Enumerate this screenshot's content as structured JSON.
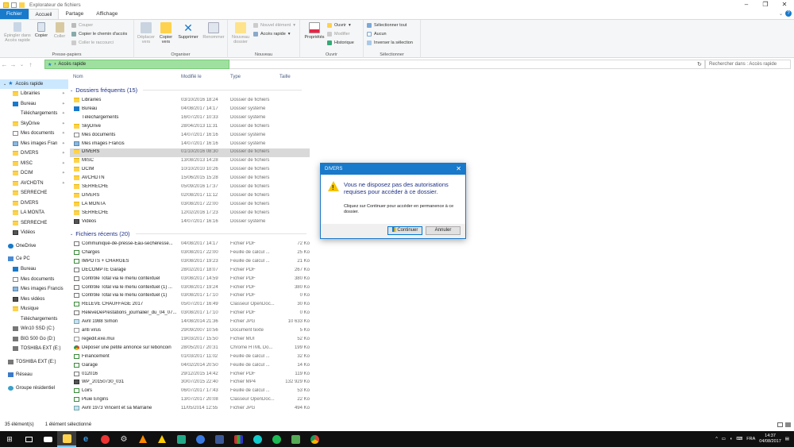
{
  "window": {
    "title": "Explorateur de fichiers"
  },
  "tabs": [
    "Fichier",
    "Accueil",
    "Partage",
    "Affichage"
  ],
  "ribbon": {
    "clipboard": {
      "pin": "Épingler dans Accès rapide",
      "copy": "Copier",
      "paste": "Coller",
      "cut": "Couper",
      "copy_path": "Copier le chemin d'accès",
      "paste_shortcut": "Coller le raccourci",
      "label": "Presse-papiers"
    },
    "organize": {
      "move": "Déplacer vers",
      "copy_to": "Copier vers",
      "delete": "Supprimer",
      "rename": "Renommer",
      "label": "Organiser"
    },
    "new": {
      "new_folder": "Nouveau dossier",
      "new_item": "Nouvel élément",
      "easy_access": "Accès rapide",
      "label": "Nouveau"
    },
    "open": {
      "properties": "Propriétés",
      "open": "Ouvrir",
      "edit": "Modifier",
      "history": "Historique",
      "label": "Ouvrir"
    },
    "select": {
      "select_all": "Sélectionner tout",
      "select_none": "Aucun",
      "invert": "Inverser la sélection",
      "label": "Sélectionner"
    }
  },
  "address": {
    "path": "Accès rapide",
    "search_placeholder": "Rechercher dans : Accès rapide"
  },
  "nav": {
    "quick_access": "Accès rapide",
    "pinned": [
      "Librairies",
      "Bureau",
      "Téléchargements",
      "SkyDrive",
      "Mes documents",
      "Mes images Fran",
      "DIVERS",
      "MISC",
      "DCIM",
      "AVCHDTN",
      "SERRECHE",
      "DIVERS",
      "LA MONTA",
      "SERRECHE",
      "Vidéos"
    ],
    "onedrive": "OneDrive",
    "this_pc": "Ce PC",
    "pc_items": [
      "Bureau",
      "Mes documents",
      "Mes images Francis",
      "Mes vidéos",
      "Musique",
      "Téléchargements",
      "Win10 SSD (C:)",
      "BIG 500 Go (D:)",
      "TOSHIBA EXT (E:)"
    ],
    "toshiba": "TOSHIBA EXT (E:)",
    "network": "Réseau",
    "homegroup": "Groupe résidentiel"
  },
  "columns": {
    "name": "Nom",
    "modified": "Modifié le",
    "type": "Type",
    "size": "Taille"
  },
  "frequent": {
    "header": "Dossiers fréquents (15)",
    "rows": [
      {
        "name": "Librairies",
        "date": "03/10/2016 18:24",
        "type": "Dossier de fichiers",
        "size": "",
        "icon": "folder"
      },
      {
        "name": "Bureau",
        "date": "04/08/2017 14:17",
        "type": "Dossier système",
        "size": "",
        "icon": "desktop"
      },
      {
        "name": "Téléchargements",
        "date": "16/07/2017 10:33",
        "type": "Dossier système",
        "size": "",
        "icon": "download"
      },
      {
        "name": "SkyDrive",
        "date": "28/04/2013 11:31",
        "type": "Dossier de fichiers",
        "size": "",
        "icon": "folder"
      },
      {
        "name": "Mes documents",
        "date": "14/07/2017 16:16",
        "type": "Dossier système",
        "size": "",
        "icon": "docs"
      },
      {
        "name": "Mes images Francis",
        "date": "14/07/2017 16:16",
        "type": "Dossier système",
        "size": "",
        "icon": "pics"
      },
      {
        "name": "DIVERS",
        "date": "01/10/2016 08:30",
        "type": "Dossier de fichiers",
        "size": "",
        "icon": "folder"
      },
      {
        "name": "MISC",
        "date": "13/08/2013 14:28",
        "type": "Dossier de fichiers",
        "size": "",
        "icon": "folder"
      },
      {
        "name": "DCIM",
        "date": "10/10/2010 10:26",
        "type": "Dossier de fichiers",
        "size": "",
        "icon": "folder"
      },
      {
        "name": "AVCHDTN",
        "date": "15/06/2015 15:28",
        "type": "Dossier de fichiers",
        "size": "",
        "icon": "folder"
      },
      {
        "name": "SERRECHE",
        "date": "05/09/2016 17:37",
        "type": "Dossier de fichiers",
        "size": "",
        "icon": "folder"
      },
      {
        "name": "DIVERS",
        "date": "02/08/2017 11:12",
        "type": "Dossier de fichiers",
        "size": "",
        "icon": "folder"
      },
      {
        "name": "LA MONTA",
        "date": "03/08/2017 22:00",
        "type": "Dossier de fichiers",
        "size": "",
        "icon": "folder"
      },
      {
        "name": "SERRECHE",
        "date": "12/02/2016 17:23",
        "type": "Dossier de fichiers",
        "size": "",
        "icon": "folder"
      },
      {
        "name": "Vidéos",
        "date": "14/07/2017 16:16",
        "type": "Dossier système",
        "size": "",
        "icon": "video"
      }
    ]
  },
  "recent": {
    "header": "Fichiers récents (20)",
    "rows": [
      {
        "name": "Communiqué-de-presse-Eau-sechéresse...",
        "date": "04/08/2017 14:17",
        "type": "Fichier PDF",
        "size": "72 Ko",
        "icon": "pdf"
      },
      {
        "name": "Charges",
        "date": "03/08/2017 22:00",
        "type": "Feuille de calcul ...",
        "size": "25 Ko",
        "icon": "sheet"
      },
      {
        "name": "IMPOTS + CHARGES",
        "date": "03/08/2017 19:23",
        "type": "Feuille de calcul ...",
        "size": "21 Ko",
        "icon": "sheet"
      },
      {
        "name": "DECOMPTE Garage",
        "date": "28/02/2017 18:07",
        "type": "Fichier PDF",
        "size": "267 Ko",
        "icon": "pdf"
      },
      {
        "name": "Contrôle Total via le menu contextuel",
        "date": "03/08/2017 14:59",
        "type": "Fichier PDF",
        "size": "380 Ko",
        "icon": "pdf"
      },
      {
        "name": "Contrôle Total via le menu contextuel (1) ...",
        "date": "03/08/2017 19:24",
        "type": "Fichier PDF",
        "size": "380 Ko",
        "icon": "pdf"
      },
      {
        "name": "Contrôle Total via le menu contextuel (1)",
        "date": "03/08/2017 17:10",
        "type": "Fichier PDF",
        "size": "0 Ko",
        "icon": "pdf"
      },
      {
        "name": "RELEVE CHAUFFAGE 2017",
        "date": "05/07/2017 16:49",
        "type": "Classeur OpenDoc...",
        "size": "30 Ko",
        "icon": "sheet"
      },
      {
        "name": "ReleveDePrestations_journalier_du_04_07...",
        "date": "03/08/2017 17:10",
        "type": "Fichier PDF",
        "size": "0 Ko",
        "icon": "pdf"
      },
      {
        "name": "Avril 1988 Simon",
        "date": "14/08/2014 21:36",
        "type": "Fichier JPG",
        "size": "10 633 Ko",
        "icon": "img"
      },
      {
        "name": "anti virus",
        "date": "29/09/2007 10:56",
        "type": "Document texte",
        "size": "5 Ko",
        "icon": "txt"
      },
      {
        "name": "regedit.exe.mui",
        "date": "19/03/2017 15:50",
        "type": "Fichier MUI",
        "size": "52 Ko",
        "icon": "txt"
      },
      {
        "name": "Déposer une petite annonce sur leboncoin",
        "date": "28/05/2017 20:31",
        "type": "Chrome HTML Do...",
        "size": "199 Ko",
        "icon": "chrome"
      },
      {
        "name": "Financement",
        "date": "01/03/2017 11:02",
        "type": "Feuille de calcul ...",
        "size": "32 Ko",
        "icon": "sheet"
      },
      {
        "name": "Garage",
        "date": "04/02/2014 20:50",
        "type": "Feuille de calcul ...",
        "size": "14 Ko",
        "icon": "sheet"
      },
      {
        "name": "012016",
        "date": "29/12/2015 14:42",
        "type": "Fichier PDF",
        "size": "119 Ko",
        "icon": "pdf"
      },
      {
        "name": "WP_20150730_031",
        "date": "30/07/2015 22:40",
        "type": "Fichier MP4",
        "size": "132 929 Ko",
        "icon": "video"
      },
      {
        "name": "Loirs",
        "date": "06/07/2017 17:43",
        "type": "Feuille de calcul ...",
        "size": "53 Ko",
        "icon": "sheet"
      },
      {
        "name": "Pluie Engins",
        "date": "13/07/2017 20:08",
        "type": "Classeur OpenDoc...",
        "size": "22 Ko",
        "icon": "sheet"
      },
      {
        "name": "Avril 1973 Vincent et sa Marraine",
        "date": "11/05/2014 12:55",
        "type": "Fichier JPG",
        "size": "494 Ko",
        "icon": "img"
      }
    ]
  },
  "status": {
    "count": "35 élément(s)",
    "selected": "1 élément sélectionné"
  },
  "dialog": {
    "title": "DIVERS",
    "message": "Vous ne disposez pas des autorisations requises pour accéder à ce dossier.",
    "sub": "Cliquez sur Continuer pour accéder en permanence à ce dossier.",
    "continue": "Continuer",
    "cancel": "Annuler"
  },
  "taskbar": {
    "lang": "FRA",
    "time": "14:37",
    "date": "04/08/2017"
  },
  "colors": {
    "accent": "#1979ca",
    "selection": "#cce8ff",
    "folder": "#ffd24d",
    "group_header": "#1e3287"
  }
}
